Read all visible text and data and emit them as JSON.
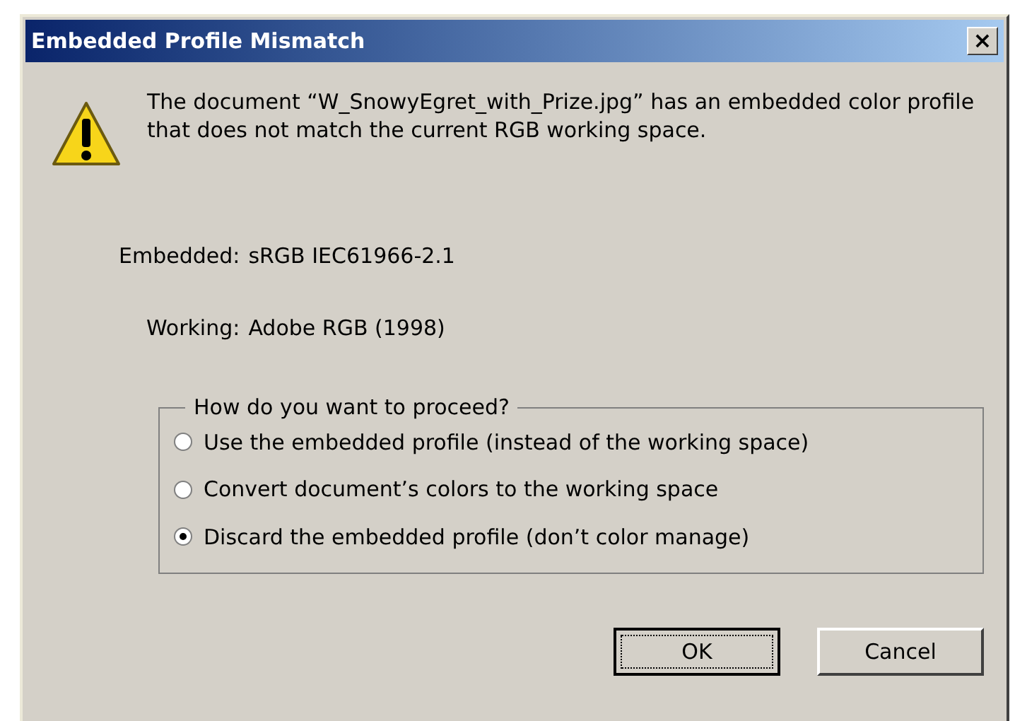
{
  "window": {
    "title": "Embedded Profile Mismatch",
    "close": "×"
  },
  "message": "The document “W_SnowyEgret_with_Prize.jpg” has an embedded color profile that does not match the current RGB working space.",
  "profiles": [
    {
      "label": "Embedded:",
      "value": "sRGB IEC61966-2.1"
    },
    {
      "label": "Working:",
      "value": "Adobe RGB (1998)"
    }
  ],
  "options": {
    "legend": "How do you want to proceed?",
    "items": [
      {
        "label": "Use the embedded profile (instead of the working space)",
        "selected": false
      },
      {
        "label": "Convert document’s colors to the working space",
        "selected": false
      },
      {
        "label": "Discard the embedded profile (don’t color manage)",
        "selected": true
      }
    ]
  },
  "buttons": [
    {
      "label": "OK",
      "focused": true
    },
    {
      "label": "Cancel",
      "focused": false
    }
  ]
}
